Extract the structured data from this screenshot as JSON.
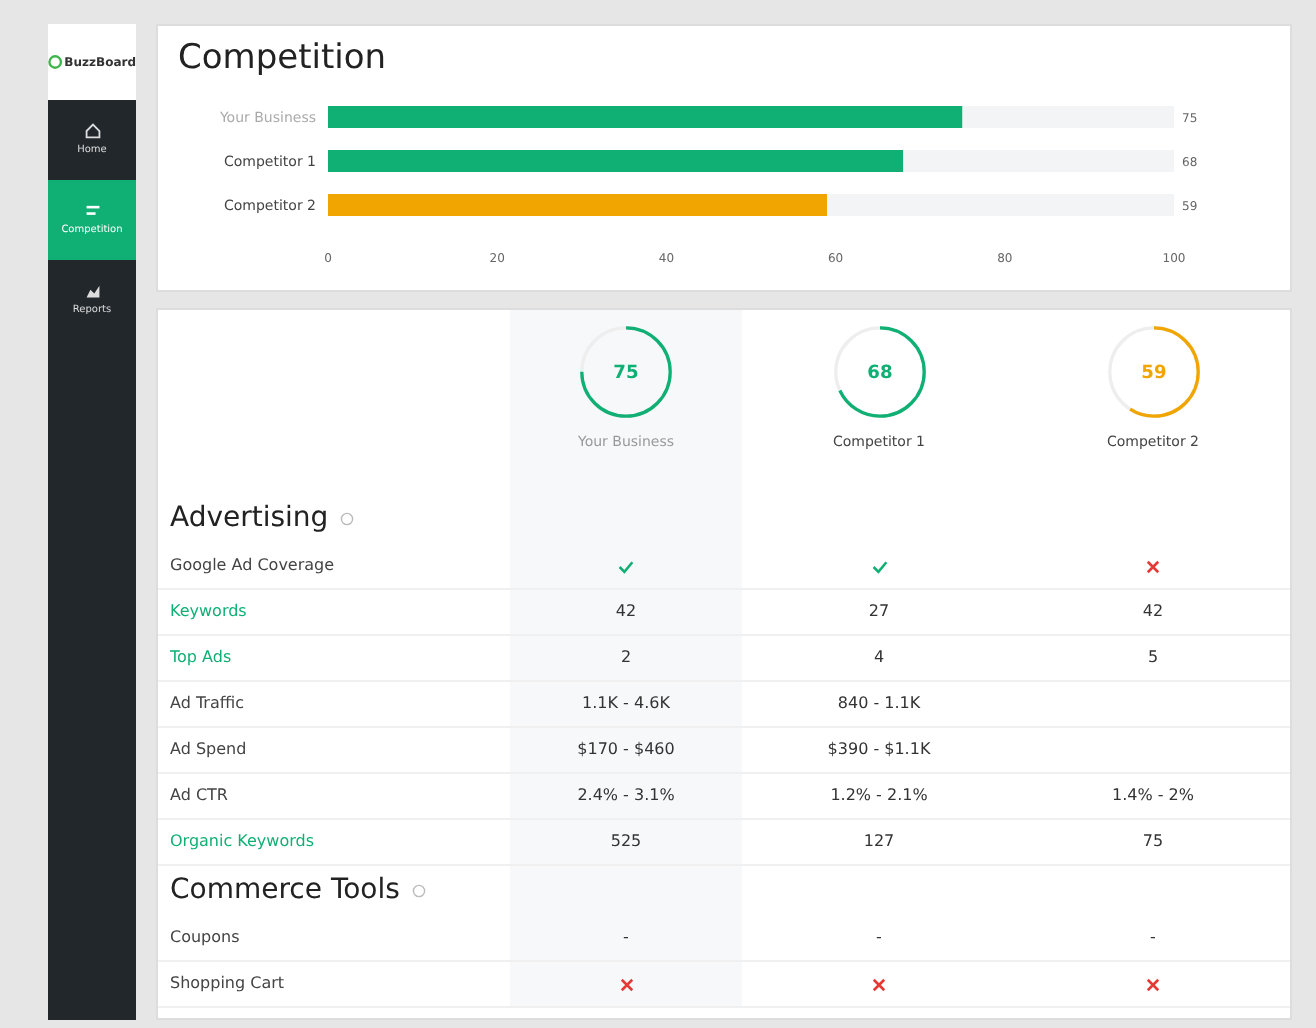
{
  "sidebar": {
    "logo": "BuzzBoard",
    "items": [
      {
        "label": "Home",
        "selected": false
      },
      {
        "label": "Competition",
        "selected": true
      },
      {
        "label": "Reports",
        "selected": false
      }
    ]
  },
  "competition": {
    "title": "Competition",
    "chart_data": {
      "type": "bar",
      "orientation": "horizontal",
      "categories": [
        "Your Business",
        "Competitor 1",
        "Competitor 2"
      ],
      "stacked": true,
      "series": [
        {
          "colors": [
            "#10b075",
            "#10b075",
            "#f0a500"
          ],
          "values": [
            75,
            68,
            59
          ]
        },
        {
          "color": "#f3f4f6",
          "values": [
            25,
            32,
            41
          ]
        }
      ],
      "xlim": [
        0,
        100
      ],
      "xticks": [
        0,
        20,
        40,
        60,
        80,
        100
      ],
      "value_labels": [
        "75",
        "68",
        "59"
      ]
    }
  },
  "businesses": [
    {
      "name": "Your Business",
      "score": "75",
      "color": "#10b075",
      "selected": true
    },
    {
      "name": "Competitor 1",
      "score": "68",
      "color": "#10b075",
      "selected": false
    },
    {
      "name": "Competitor 2",
      "score": "59",
      "color": "#f0a500",
      "selected": false
    }
  ],
  "sections": [
    {
      "title": "Advertising",
      "rows": [
        {
          "label": "Google Ad Coverage",
          "link": false,
          "cells": [
            {
              "kind": "check"
            },
            {
              "kind": "check"
            },
            {
              "kind": "cross"
            }
          ]
        },
        {
          "label": "Keywords",
          "link": true,
          "cells": [
            {
              "kind": "text",
              "text": "42"
            },
            {
              "kind": "text",
              "text": "27"
            },
            {
              "kind": "text",
              "text": "42"
            }
          ]
        },
        {
          "label": "Top Ads",
          "link": true,
          "cells": [
            {
              "kind": "text",
              "text": "2"
            },
            {
              "kind": "text",
              "text": "4"
            },
            {
              "kind": "text",
              "text": "5"
            }
          ]
        },
        {
          "label": "Ad Traffic",
          "link": false,
          "cells": [
            {
              "kind": "text",
              "text": "1.1K - 4.6K"
            },
            {
              "kind": "text",
              "text": "840 - 1.1K"
            },
            {
              "kind": "empty"
            }
          ]
        },
        {
          "label": "Ad Spend",
          "link": false,
          "cells": [
            {
              "kind": "text",
              "text": "$170 - $460"
            },
            {
              "kind": "text",
              "text": "$390 - $1.1K"
            },
            {
              "kind": "empty"
            }
          ]
        },
        {
          "label": "Ad CTR",
          "link": false,
          "cells": [
            {
              "kind": "text",
              "text": "2.4% - 3.1%"
            },
            {
              "kind": "text",
              "text": "1.2% - 2.1%"
            },
            {
              "kind": "text",
              "text": "1.4% - 2%"
            }
          ]
        },
        {
          "label": "Organic Keywords",
          "link": true,
          "cells": [
            {
              "kind": "text",
              "text": "525"
            },
            {
              "kind": "text",
              "text": "127"
            },
            {
              "kind": "text",
              "text": "75"
            }
          ]
        }
      ]
    },
    {
      "title": "Commerce Tools",
      "rows": [
        {
          "label": "Coupons",
          "link": false,
          "cells": [
            {
              "kind": "text",
              "text": "-"
            },
            {
              "kind": "text",
              "text": "-"
            },
            {
              "kind": "text",
              "text": "-"
            }
          ]
        },
        {
          "label": "Shopping Cart",
          "link": false,
          "cells": [
            {
              "kind": "cross"
            },
            {
              "kind": "cross"
            },
            {
              "kind": "cross"
            }
          ]
        }
      ]
    }
  ]
}
